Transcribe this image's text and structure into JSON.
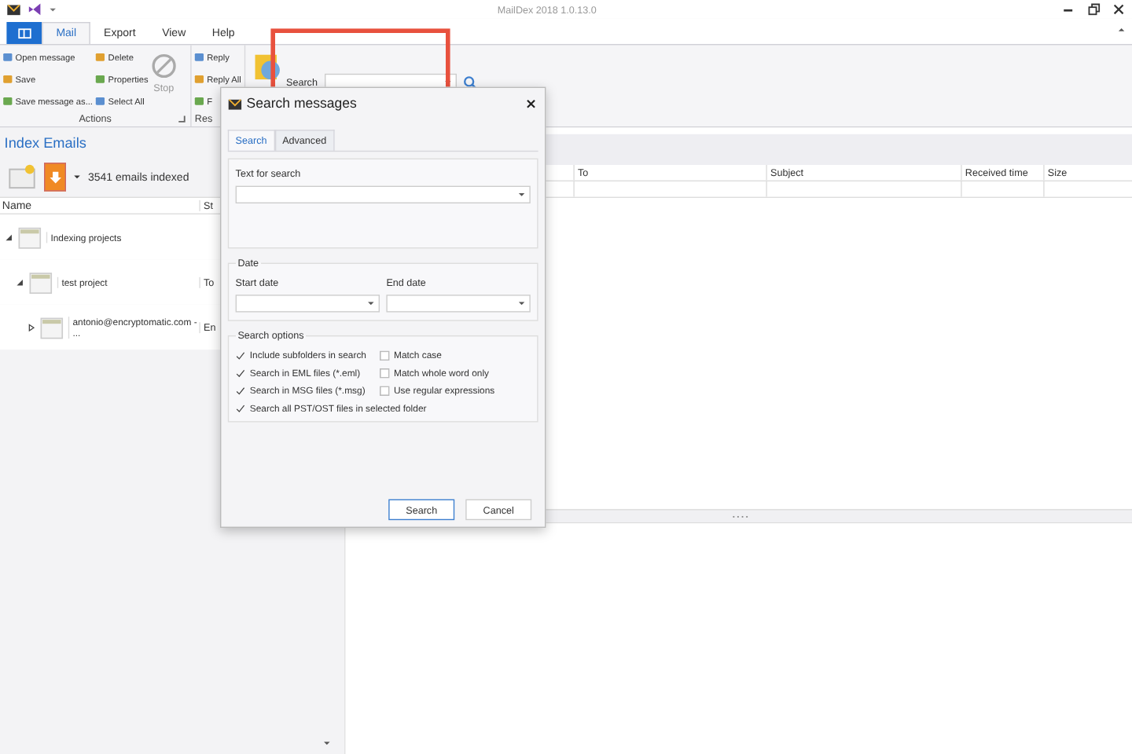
{
  "window": {
    "title": "MailDex 2018 1.0.13.0"
  },
  "ribbon_tabs": [
    {
      "label": "Mail",
      "selected": true
    },
    {
      "label": "Export",
      "selected": false
    },
    {
      "label": "View",
      "selected": false
    },
    {
      "label": "Help",
      "selected": false
    }
  ],
  "ribbon_groups": [
    {
      "label": "Actions",
      "columns": [
        [
          "Open message",
          "Save",
          "Save message as..."
        ],
        [
          "Delete",
          "Properties",
          "Select All"
        ]
      ],
      "large": {
        "label": "Stop",
        "disabled": true
      }
    },
    {
      "label": "Res",
      "columns": [
        [
          "Reply",
          "Reply All",
          "F"
        ]
      ]
    }
  ],
  "ribbon_search": {
    "label": "Search"
  },
  "left_pane": {
    "title": "Index Emails",
    "status": "3541 emails indexed",
    "columns": [
      "Name",
      "St"
    ],
    "tree": [
      {
        "label": "Indexing projects",
        "expanded": true,
        "children": [
          {
            "label": "test project",
            "column_2": "To",
            "expanded": true,
            "children": [
              {
                "label": "antonio@encryptomatic.com - ...",
                "column_2": "En",
                "expanded": false
              }
            ]
          }
        ]
      }
    ]
  },
  "message_list": {
    "columns": [
      "To",
      "Subject",
      "Received time",
      "Size"
    ]
  },
  "dialog": {
    "title": "Search messages",
    "tabs": [
      {
        "label": "Search",
        "selected": true
      },
      {
        "label": "Advanced",
        "selected": false
      }
    ],
    "text_label": "Text for search",
    "date_section": {
      "title": "Date",
      "start_label": "Start date",
      "end_label": "End date"
    },
    "options_section": {
      "title": "Search options",
      "options": [
        {
          "label": "Include subfolders in search",
          "checked": true
        },
        {
          "label": "Match case",
          "checked": false
        },
        {
          "label": "Search in EML files (*.eml)",
          "checked": true
        },
        {
          "label": "Match whole word only",
          "checked": false
        },
        {
          "label": "Search in MSG files (*.msg)",
          "checked": true
        },
        {
          "label": "Use regular expressions",
          "checked": false
        },
        {
          "label": "Search all PST/OST files in selected folder",
          "checked": true
        }
      ]
    },
    "buttons": [
      {
        "label": "Search",
        "default": true
      },
      {
        "label": "Cancel",
        "default": false
      }
    ]
  }
}
